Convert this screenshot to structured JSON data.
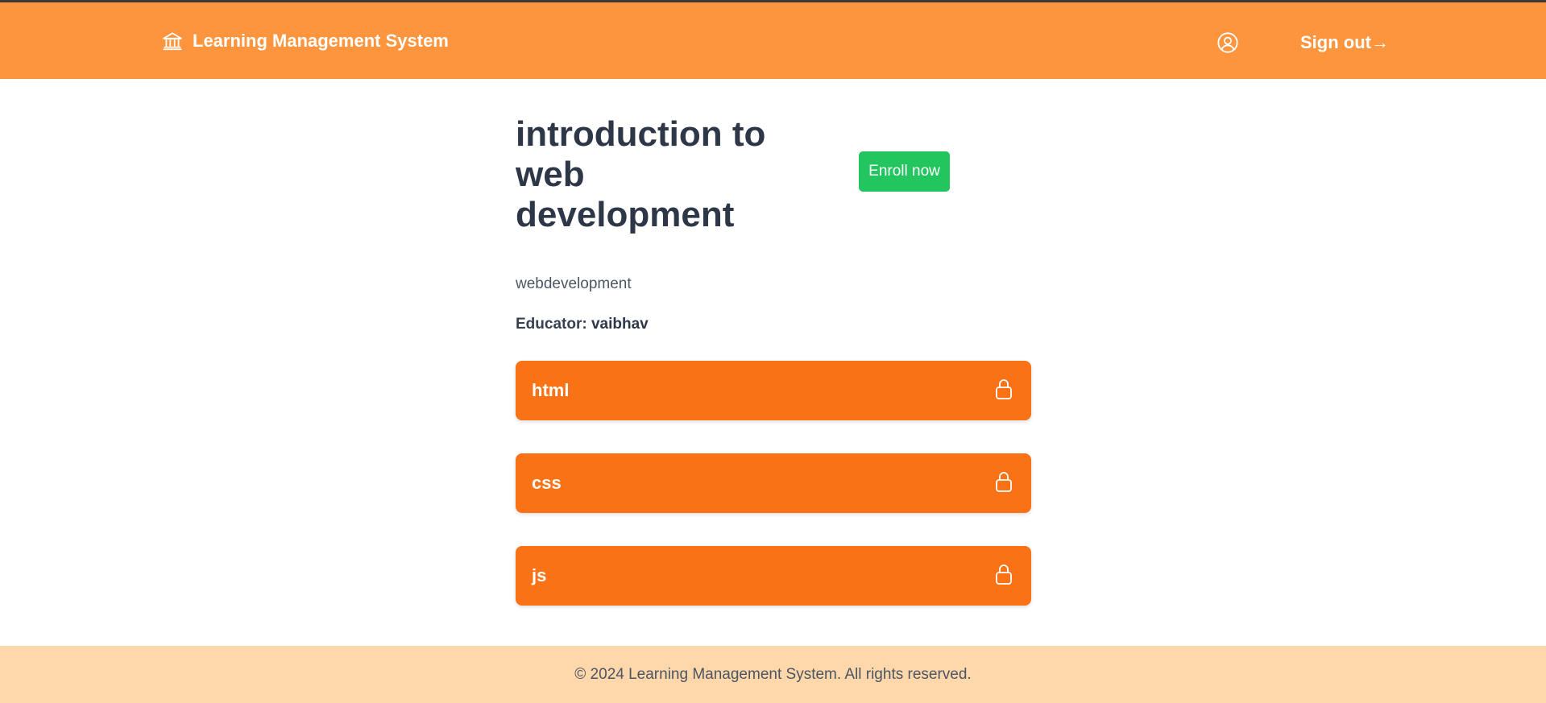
{
  "header": {
    "brand_icon": "bank-building-icon",
    "brand_title": "Learning Management System",
    "profile_icon": "user-circle-icon",
    "signout_label": "Sign out→"
  },
  "course": {
    "title": "introduction to web development",
    "enroll_label": "Enroll now",
    "category": "webdevelopment",
    "educator_label": "Educator:",
    "educator_name": "vaibhav"
  },
  "lessons": [
    {
      "label": "html",
      "icon": "lock-icon"
    },
    {
      "label": "css",
      "icon": "lock-icon"
    },
    {
      "label": "js",
      "icon": "lock-icon"
    }
  ],
  "footer": {
    "copyright": "© 2024 Learning Management System. All rights reserved."
  },
  "colors": {
    "header_bg": "#fd953e",
    "lesson_bg": "#f97316",
    "enroll_bg": "#22c55e",
    "footer_bg": "#fed7aa"
  }
}
